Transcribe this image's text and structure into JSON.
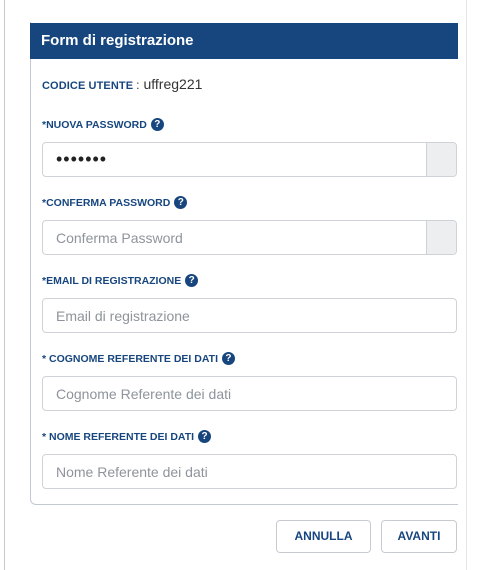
{
  "header": {
    "title": "Form di registrazione"
  },
  "user_code": {
    "label": "CODICE UTENTE",
    "separator": ":",
    "value": "uffreg221"
  },
  "fields": {
    "new_password": {
      "label": "*NUOVA PASSWORD",
      "value": "•••••••",
      "placeholder": ""
    },
    "confirm_password": {
      "label": "*CONFERMA PASSWORD",
      "value": "",
      "placeholder": "Conferma Password"
    },
    "email": {
      "label": "*EMAIL DI REGISTRAZIONE",
      "value": "",
      "placeholder": "Email di registrazione"
    },
    "surname": {
      "label": "* COGNOME REFERENTE DEI DATI",
      "value": "",
      "placeholder": "Cognome Referente dei dati"
    },
    "name": {
      "label": "* NOME REFERENTE DEI DATI",
      "value": "",
      "placeholder": "Nome Referente dei dati"
    }
  },
  "help_icon": {
    "glyph": "?",
    "icon": "question-circle-icon"
  },
  "buttons": {
    "cancel": "ANNULLA",
    "next": "AVANTI"
  },
  "colors": {
    "accent": "#17467f",
    "header_bg": "#17467f",
    "addon_bg": "#eceeef"
  }
}
